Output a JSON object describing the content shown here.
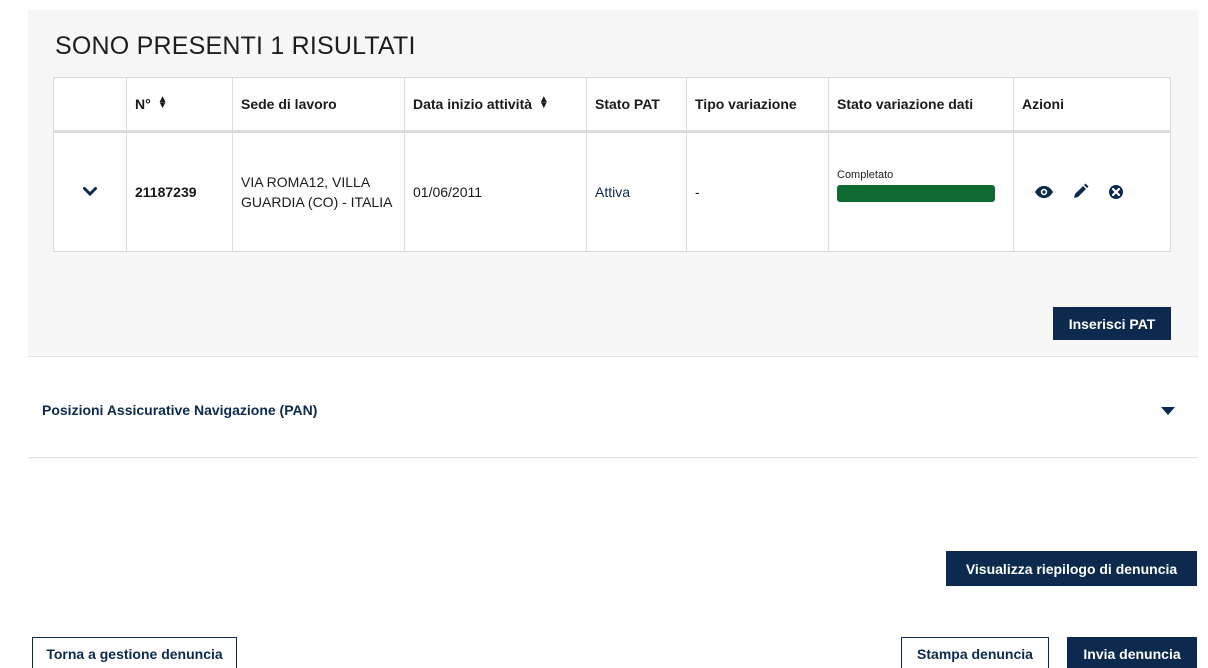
{
  "results": {
    "title": "SONO PRESENTI 1 RISULTATI",
    "columns": [
      "",
      "N°",
      "Sede di lavoro",
      "Data inizio attività",
      "Stato PAT",
      "Tipo variazione",
      "Stato variazione dati",
      "Azioni"
    ],
    "rows": [
      {
        "expand_icon": "chevron-down-icon",
        "numero": "21187239",
        "sede": "VIA ROMA12, VILLA GUARDIA (CO) - ITALIA",
        "data_inizio": "01/06/2011",
        "stato_pat": "Attiva",
        "tipo_variazione": "-",
        "stato_variazione": "Completato",
        "progress": 1.0,
        "actions": [
          "eye-icon",
          "pencil-icon",
          "close-circle-icon"
        ]
      }
    ],
    "insert_button": "Inserisci PAT"
  },
  "pan": {
    "title": "Posizioni Assicurative Navigazione (PAN)",
    "icon": "caret-down-icon"
  },
  "footer": {
    "summary_button": "Visualizza riepilogo di denuncia",
    "back_button": "Torna a gestione denuncia",
    "print_button": "Stampa denuncia",
    "send_button": "Invia denuncia"
  },
  "colors": {
    "primary": "#0b2a4d",
    "progress_complete": "#0f6a31",
    "panel_bg": "#f7f7f8"
  }
}
